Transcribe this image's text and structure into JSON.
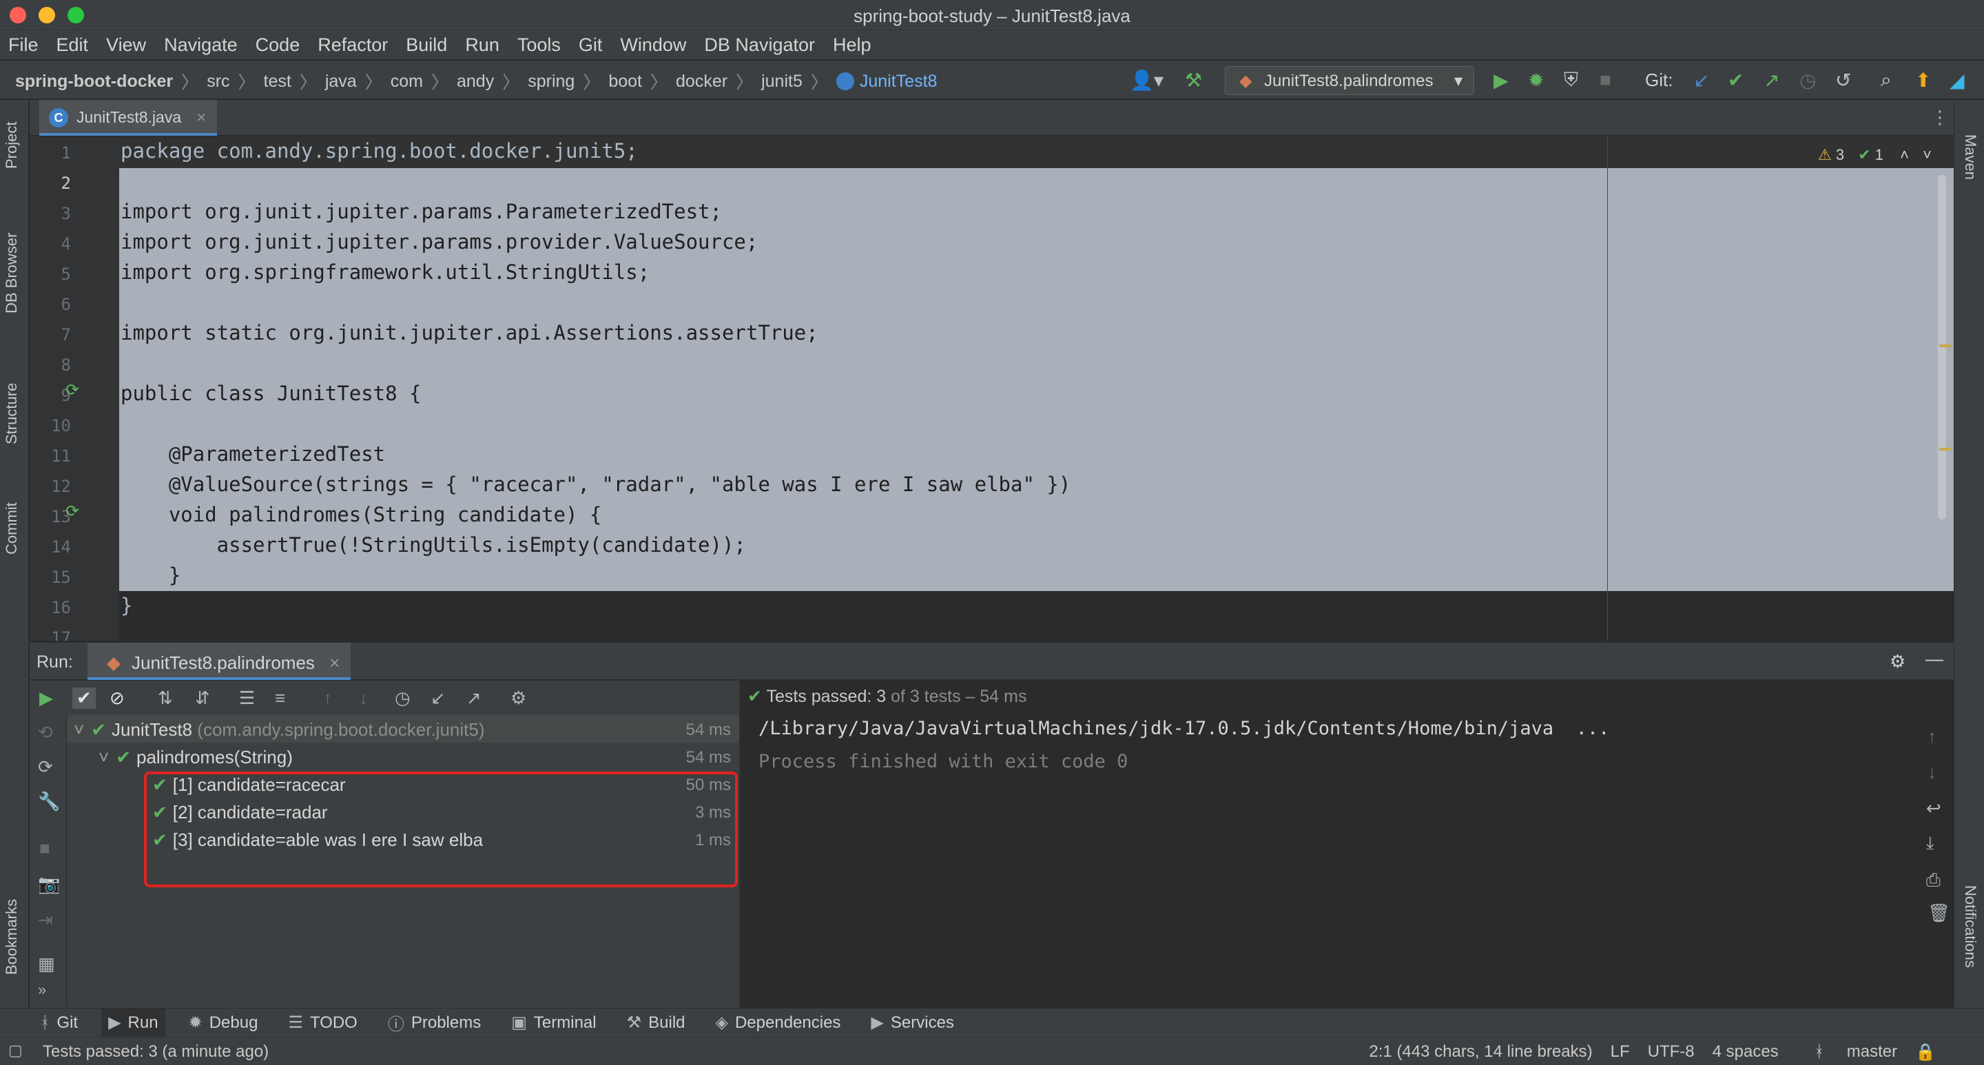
{
  "window": {
    "title": "spring-boot-study – JunitTest8.java"
  },
  "menu": [
    "File",
    "Edit",
    "View",
    "Navigate",
    "Code",
    "Refactor",
    "Build",
    "Run",
    "Tools",
    "Git",
    "Window",
    "DB Navigator",
    "Help"
  ],
  "breadcrumbs": [
    "spring-boot-docker",
    "src",
    "test",
    "java",
    "com",
    "andy",
    "spring",
    "boot",
    "docker",
    "junit5",
    "JunitTest8"
  ],
  "run_config": "JunitTest8.palindromes",
  "git_label": "Git:",
  "left_tabs": [
    "Project",
    "DB Browser",
    "Structure",
    "Commit",
    "Bookmarks"
  ],
  "right_tabs": [
    "Maven",
    "Notifications"
  ],
  "editor": {
    "file_tab": "JunitTest8.java",
    "inspections": {
      "warnings": "3",
      "ok": "1"
    },
    "line_numbers": [
      "1",
      "2",
      "3",
      "4",
      "5",
      "6",
      "7",
      "8",
      "9",
      "10",
      "11",
      "12",
      "13",
      "14",
      "15",
      "16",
      "17"
    ],
    "lines": [
      "package com.andy.spring.boot.docker.junit5;",
      "",
      "import org.junit.jupiter.params.ParameterizedTest;",
      "import org.junit.jupiter.params.provider.ValueSource;",
      "import org.springframework.util.StringUtils;",
      "",
      "import static org.junit.jupiter.api.Assertions.assertTrue;",
      "",
      "public class JunitTest8 {",
      "",
      "    @ParameterizedTest",
      "    @ValueSource(strings = { \"racecar\", \"radar\", \"able was I ere I saw elba\" })",
      "    void palindromes(String candidate) {",
      "        assertTrue(!StringUtils.isEmpty(candidate));",
      "    }",
      "}"
    ]
  },
  "run_panel": {
    "label": "Run:",
    "tab": "JunitTest8.palindromes",
    "summary_prefix": "Tests passed:",
    "summary_count": "3",
    "summary_suffix": "of 3 tests – 54 ms",
    "tree": [
      {
        "name": "JunitTest8",
        "detail": "(com.andy.spring.boot.docker.junit5)",
        "duration": "54 ms"
      },
      {
        "name": "palindromes(String)",
        "detail": "",
        "duration": "54 ms"
      },
      {
        "name": "[1] candidate=racecar",
        "detail": "",
        "duration": "50 ms"
      },
      {
        "name": "[2] candidate=radar",
        "detail": "",
        "duration": "3 ms"
      },
      {
        "name": "[3] candidate=able was I ere I saw elba",
        "detail": "",
        "duration": "1 ms"
      }
    ],
    "console": [
      "/Library/Java/JavaVirtualMachines/jdk-17.0.5.jdk/Contents/Home/bin/java  ...",
      "Process finished with exit code 0"
    ]
  },
  "tool_windows": [
    "Git",
    "Run",
    "Debug",
    "TODO",
    "Problems",
    "Terminal",
    "Build",
    "Dependencies",
    "Services"
  ],
  "status": {
    "message": "Tests passed: 3 (a minute ago)",
    "position": "2:1 (443 chars, 14 line breaks)",
    "line_sep": "LF",
    "encoding": "UTF-8",
    "indent": "4 spaces",
    "branch": "master"
  },
  "colors": {
    "accent": "#4a88c7",
    "pass": "#5fb35f",
    "highlight_box": "#e0221f",
    "selection": "#a9b0ba"
  }
}
